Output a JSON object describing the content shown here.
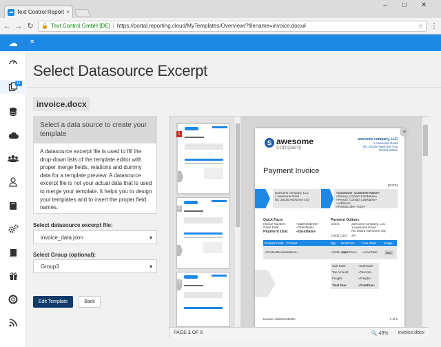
{
  "browser": {
    "tab_title": "Text Control ReportingC",
    "tab_close": "×",
    "org": "Text Control GmbH [DE]",
    "url": "https://portal.reporting.cloud/MyTemplates/Overview/?filename=invoice.docx#",
    "window_controls": [
      "–",
      "□",
      "✕"
    ]
  },
  "sidebar": {
    "badge": "14",
    "icons": [
      "dashboard-icon",
      "templates-icon",
      "database-icon",
      "cloud-icon",
      "users-icon",
      "user-icon",
      "book-icon",
      "settings-icon",
      "docs-icon",
      "gift-icon",
      "support-icon",
      "rss-icon"
    ]
  },
  "main": {
    "title": "Select Datasource Excerpt",
    "filename": "invoice.docx",
    "panel_heading": "Select a data source to create your template",
    "panel_text": "A datasource excerpt file is used to fill the drop-down lists of the template editor with proper merge fields, relations and dummy data for a template preview. A datasource excerpt file is not your actual data that is used to merge your template. It helps you to design your templates and to insert the proper field names.",
    "excerpt_label": "Select datasource excerpt file:",
    "excerpt_value": "invoice_data.json",
    "group_label": "Select Group (optional):",
    "group_value": "Group3",
    "edit_button": "Edit Template",
    "back_button": "Back"
  },
  "viewer": {
    "thumb_numbers": [
      "1",
      "2",
      "3"
    ],
    "page_indicator_prefix": "PAGE ",
    "page_current": "1",
    "page_indicator_suffix": " OF 6",
    "zoom": "49%",
    "file": "invoice.docx"
  },
  "document": {
    "logo_main": "awesome",
    "logo_sub": "company",
    "company_name": "awesome company, LLC",
    "company_addr1": "1 Awesome Road",
    "company_addr2": "NC 28226 Awesome City",
    "company_country": "United States",
    "heading": "Payment Invoice",
    "date_field": "[DATE]",
    "from_block": [
      "awesome company, LLC",
      "1 Awesome Road",
      "NC 28226 Awesome City"
    ],
    "to_block": [
      "«Customer_Customer Name»",
      "«Person_Contact FirstName»",
      "«Person_Contact LastName»",
      "«Address»",
      "«PostalCode» «City»"
    ],
    "quick_facts_title": "Quick Facts",
    "quick_facts": [
      [
        "Invoice Number:",
        "«SalesOrderID»"
      ],
      [
        "Order Date:",
        "«OrderDate»"
      ]
    ],
    "payment_due_label": "Payment Due:",
    "payment_due_value": "«DueDate»",
    "payment_options_title": "Payment Options",
    "payment_options": [
      [
        "Check",
        "awesome company, LLC"
      ],
      [
        "",
        "1 Awesome Road"
      ],
      [
        "",
        "NC 28226 Awesome City"
      ],
      [
        "Credit Card",
        "SFI"
      ]
    ],
    "table_headers": [
      "Product Code",
      "Product",
      "Qty",
      "Unit Price",
      "Line Total",
      "Image"
    ],
    "table_row": [
      "«ProductNumber»",
      "«Name»",
      "«Order Qty»",
      "«UnitPrice»",
      "«LineTotal»",
      "IMG"
    ],
    "totals": [
      [
        "Sub Total:",
        "«SubTotal»"
      ],
      [
        "Tax Amount:",
        "«TaxAmt»"
      ],
      [
        "Freight:",
        "«Freight»"
      ],
      [
        "Total Due:",
        "«TotalDue»"
      ]
    ],
    "footer_left": "Invoice «SalesOrderID»",
    "footer_right": "1 of 6"
  },
  "colors": {
    "brand": "#1e88e5",
    "primary_button": "#0e3a6a",
    "thumb_badge": "#c62828",
    "thumb_badge_inactive": "#bdbdbd"
  }
}
